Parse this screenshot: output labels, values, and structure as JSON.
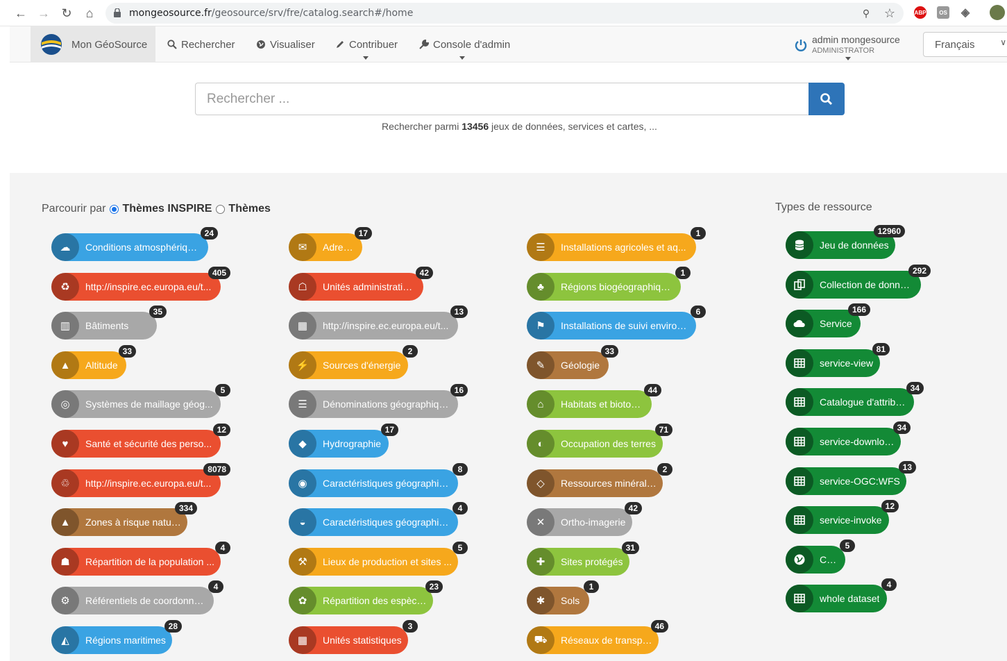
{
  "browser": {
    "url_host": "mongeosource.fr",
    "url_path": "/geosource/srv/fre/catalog.search#/home"
  },
  "nav": {
    "brand": "Mon GéoSource",
    "items": [
      {
        "label": "Rechercher",
        "icon": "search-icon"
      },
      {
        "label": "Visualiser",
        "icon": "globe-icon"
      },
      {
        "label": "Contribuer",
        "icon": "pencil-icon"
      },
      {
        "label": "Console d'admin",
        "icon": "wrench-icon"
      }
    ],
    "user_name": "admin mongesource",
    "user_role": "ADMINISTRATOR",
    "language": "Français"
  },
  "search": {
    "placeholder": "Rechercher ...",
    "hint_before": "Rechercher parmi",
    "count": "13456",
    "hint_after": "jeux de données, services et cartes, ..."
  },
  "browse": {
    "label": "Parcourir par",
    "option_inspire": "Thèmes INSPIRE",
    "option_themes": "Thèmes",
    "types_title": "Types de ressource"
  },
  "themes": [
    {
      "label": "Conditions atmosphériques",
      "count": "24",
      "color": "#3aa3e3"
    },
    {
      "label": "http://inspire.ec.europa.eu/t...",
      "count": "405",
      "color": "#ea4f30"
    },
    {
      "label": "Bâtiments",
      "count": "35",
      "color": "#a8a8a8"
    },
    {
      "label": "Altitude",
      "count": "33",
      "color": "#f6a81c"
    },
    {
      "label": "Systèmes de maillage géog...",
      "count": "5",
      "color": "#a8a8a8"
    },
    {
      "label": "Santé et sécurité des perso...",
      "count": "12",
      "color": "#ea4f30"
    },
    {
      "label": "http://inspire.ec.europa.eu/t...",
      "count": "8078",
      "color": "#ea4f30"
    },
    {
      "label": "Zones à risque naturel",
      "count": "334",
      "color": "#b0773e"
    },
    {
      "label": "Répartition de la population ...",
      "count": "4",
      "color": "#ea4f30"
    },
    {
      "label": "Référentiels de coordonnées",
      "count": "4",
      "color": "#a8a8a8"
    },
    {
      "label": "Régions maritimes",
      "count": "28",
      "color": "#3aa3e3"
    },
    {
      "label": "Adresses",
      "count": "17",
      "color": "#f6a81c"
    },
    {
      "label": "Unités administratives",
      "count": "42",
      "color": "#ea4f30"
    },
    {
      "label": "http://inspire.ec.europa.eu/t...",
      "count": "13",
      "color": "#a8a8a8"
    },
    {
      "label": "Sources d'énergie",
      "count": "2",
      "color": "#f6a81c"
    },
    {
      "label": "Dénominations géographiqu...",
      "count": "16",
      "color": "#a8a8a8"
    },
    {
      "label": "Hydrographie",
      "count": "17",
      "color": "#3aa3e3"
    },
    {
      "label": "Caractéristiques géographiq...",
      "count": "8",
      "color": "#3aa3e3"
    },
    {
      "label": "Caractéristiques géographiq...",
      "count": "4",
      "color": "#3aa3e3"
    },
    {
      "label": "Lieux de production et sites ...",
      "count": "5",
      "color": "#f6a81c"
    },
    {
      "label": "Répartition des espèces",
      "count": "23",
      "color": "#8dc43e"
    },
    {
      "label": "Unités statistiques",
      "count": "3",
      "color": "#ea4f30"
    },
    {
      "label": "Installations agricoles et aq...",
      "count": "1",
      "color": "#f6a81c"
    },
    {
      "label": "Régions biogéographiques",
      "count": "1",
      "color": "#8dc43e"
    },
    {
      "label": "Installations de suivi environ...",
      "count": "6",
      "color": "#3aa3e3"
    },
    {
      "label": "Géologie",
      "count": "33",
      "color": "#b0773e"
    },
    {
      "label": "Habitats et biotopes",
      "count": "44",
      "color": "#8dc43e"
    },
    {
      "label": "Occupation des terres",
      "count": "71",
      "color": "#8dc43e"
    },
    {
      "label": "Ressources minérales",
      "count": "2",
      "color": "#b0773e"
    },
    {
      "label": "Ortho-imagerie",
      "count": "42",
      "color": "#a8a8a8"
    },
    {
      "label": "Sites protégés",
      "count": "31",
      "color": "#8dc43e"
    },
    {
      "label": "Sols",
      "count": "1",
      "color": "#b0773e"
    },
    {
      "label": "Réseaux de transport",
      "count": "46",
      "color": "#f6a81c"
    }
  ],
  "resource_types": [
    {
      "label": "Jeu de données",
      "count": "12960",
      "icon": "database-icon"
    },
    {
      "label": "Collection de données",
      "count": "292",
      "icon": "copy-icon"
    },
    {
      "label": "Service",
      "count": "166",
      "icon": "cloud-icon"
    },
    {
      "label": "service-view",
      "count": "81",
      "icon": "table-icon"
    },
    {
      "label": "Catalogue d'attributs",
      "count": "34",
      "icon": "table-icon"
    },
    {
      "label": "service-download",
      "count": "34",
      "icon": "table-icon"
    },
    {
      "label": "service-OGC:WFS",
      "count": "13",
      "icon": "table-icon"
    },
    {
      "label": "service-invoke",
      "count": "12",
      "icon": "table-icon"
    },
    {
      "label": "Carte",
      "count": "5",
      "icon": "globe-icon"
    },
    {
      "label": "whole dataset",
      "count": "4",
      "icon": "table-icon"
    }
  ]
}
